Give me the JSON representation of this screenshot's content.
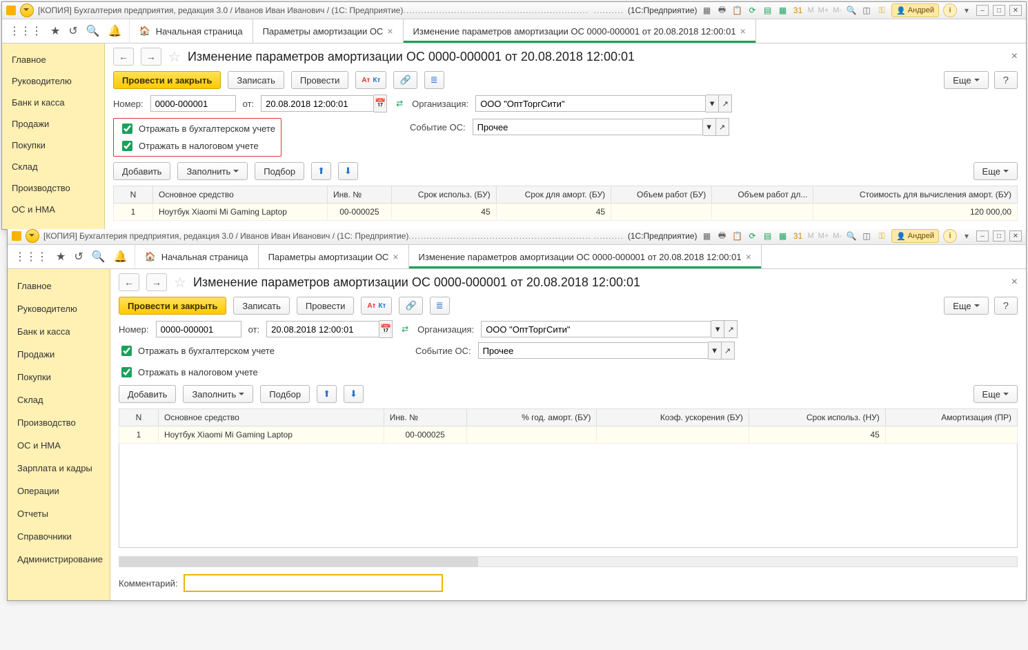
{
  "titlebar_text": "[КОПИЯ] Бухгалтерия предприятия, редакция 3.0 / Иванов Иван Иванович / (1С: Предприятие)",
  "product_text": "(1С:Предприятие)",
  "user_name": "Андрей",
  "m_labels": {
    "m": "M",
    "mplus": "M+",
    "mminus": "M-"
  },
  "tabs": {
    "home": "Начальная страница",
    "t1": "Параметры амортизации ОС",
    "t2": "Изменение параметров амортизации ОС 0000-000001 от 20.08.2018 12:00:01"
  },
  "sidebar": {
    "items": [
      "Главное",
      "Руководителю",
      "Банк и касса",
      "Продажи",
      "Покупки",
      "Склад",
      "Производство",
      "ОС и НМА",
      "Зарплата и кадры",
      "Операции",
      "Отчеты",
      "Справочники",
      "Администрирование"
    ]
  },
  "page": {
    "title": "Изменение параметров амортизации ОС 0000-000001 от 20.08.2018 12:00:01"
  },
  "buttons": {
    "post_close": "Провести и закрыть",
    "write": "Записать",
    "post": "Провести",
    "more": "Еще",
    "help": "?",
    "add": "Добавить",
    "fill": "Заполнить",
    "pick": "Подбор"
  },
  "fields": {
    "number_label": "Номер:",
    "number_value": "0000-000001",
    "from_label": "от:",
    "date_value": "20.08.2018 12:00:01",
    "org_label": "Организация:",
    "org_value": "ООО \"ОптТоргСити\"",
    "event_label": "Событие ОС:",
    "event_value": "Прочее",
    "chk_bu": "Отражать в бухгалтерском учете",
    "chk_nu": "Отражать в налоговом учете",
    "comment_label": "Комментарий:"
  },
  "table1": {
    "cols": [
      "N",
      "Основное средство",
      "Инв. №",
      "Срок использ. (БУ)",
      "Срок для аморт. (БУ)",
      "Объем работ (БУ)",
      "Объем работ дл...",
      "Стоимость для вычисления аморт. (БУ)"
    ],
    "row": {
      "n": "1",
      "asset": "Ноутбук Xiaomi Mi Gaming Laptop",
      "inv": "00-000025",
      "use": "45",
      "amort": "45",
      "vol": "",
      "vol2": "",
      "cost": "120 000,00"
    }
  },
  "table2": {
    "cols": [
      "N",
      "Основное средство",
      "Инв. №",
      "% год. аморт. (БУ)",
      "Коэф. ускорения (БУ)",
      "Срок использ. (НУ)",
      "Амортизация (ПР)"
    ],
    "row": {
      "n": "1",
      "asset": "Ноутбук Xiaomi Mi Gaming Laptop",
      "inv": "00-000025",
      "pct": "",
      "coef": "",
      "nu": "45",
      "pr": ""
    }
  }
}
